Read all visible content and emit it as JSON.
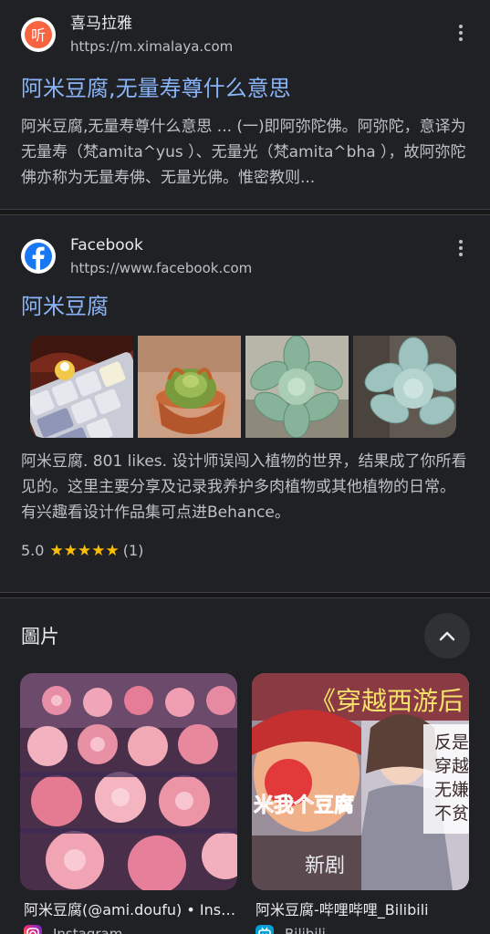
{
  "results": [
    {
      "site_name": "喜马拉雅",
      "site_url": "https://m.ximalaya.com",
      "favicon_glyph": "听",
      "title": "阿米豆腐,无量寿尊什么意思",
      "snippet": "阿米豆腐,无量寿尊什么意思 ... (一)即阿弥陀佛。阿弥陀，意译为无量寿（梵amita^yus ）、无量光（梵amita^bha ），故阿弥陀佛亦称为无量寿佛、无量光佛。惟密教则...",
      "favicon_color": "#f86442"
    },
    {
      "site_name": "Facebook",
      "site_url": "https://www.facebook.com",
      "title": "阿米豆腐",
      "snippet": "阿米豆腐. 801 likes. 设计师误闯入植物的世界，结果成了你所看见的。这里主要分享及记录我养护多肉植物或其他植物的日常。有兴趣看设计作品集可点进Behance。",
      "rating": "5.0",
      "rating_count": "(1)",
      "stars": 5,
      "favicon_color": "#1877f2"
    }
  ],
  "images": {
    "section_title": "圖片",
    "cards": [
      {
        "title": "阿米豆腐(@ami.doufu) • Inst...",
        "source": "Instagram"
      },
      {
        "title": "阿米豆腐-哔哩哔哩_Bilibili",
        "source": "Bilibili"
      }
    ]
  },
  "thumb_texts": {
    "card2_banner": "《穿越西游后",
    "card2_left": "米我个豆腐",
    "card2_bottom": "新剧",
    "card2_side_1": "反是",
    "card2_side_2": "穿越",
    "card2_side_3": "无嫌",
    "card2_side_4": "不贫"
  }
}
